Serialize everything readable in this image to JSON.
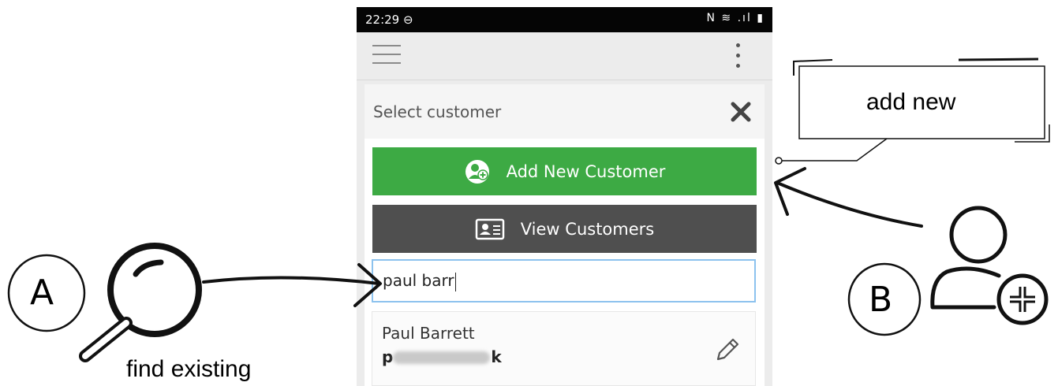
{
  "status_bar": {
    "time": "22:29 ⊖",
    "icons": "N ≋ .ıl ▮"
  },
  "dialog": {
    "title": "Select customer"
  },
  "buttons": {
    "add_new": "Add New Customer",
    "view": "View Customers"
  },
  "search": {
    "value": "paul barr"
  },
  "results": [
    {
      "name": "Paul Barrett",
      "email_visible_start": "p",
      "email_visible_end": "k"
    }
  ],
  "annotations": {
    "find_existing": "find existing",
    "add_new": "add new",
    "marker_a": "A",
    "marker_b": "B"
  },
  "colors": {
    "add_button": "#3daa44",
    "view_button": "#4f4f4f",
    "search_border": "#8cc2ee"
  },
  "icons": [
    "menu-icon",
    "more-vert-icon",
    "close-icon",
    "add-user-icon",
    "contact-card-icon",
    "edit-pencil-icon",
    "magnifier-icon",
    "user-add-icon"
  ]
}
